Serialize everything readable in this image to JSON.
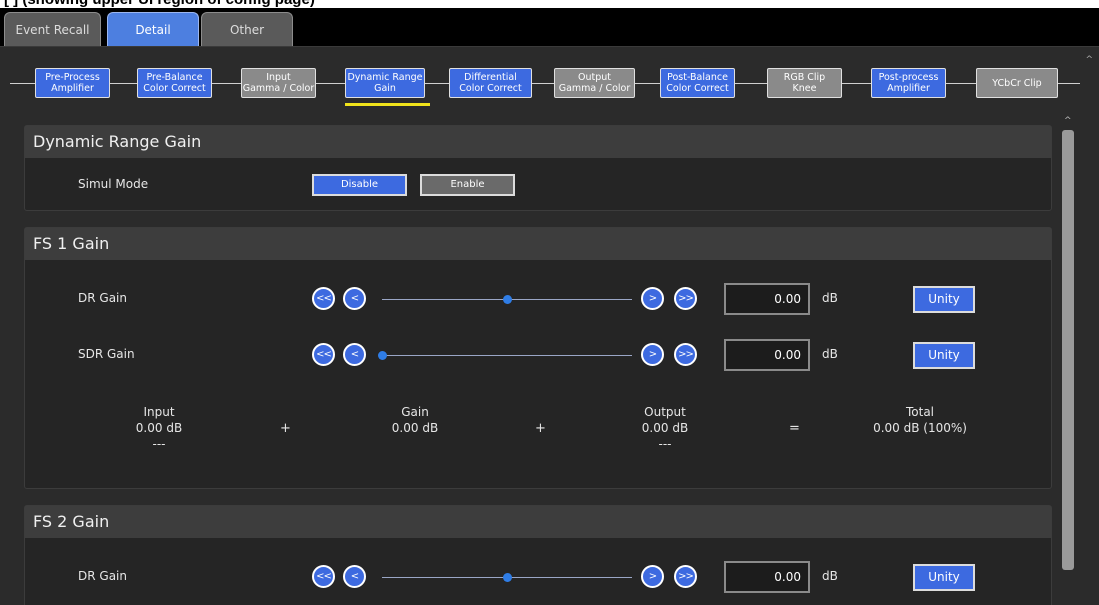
{
  "window": {
    "title_strip": "[ ] (showing upper UI region of config page)"
  },
  "tabs": [
    {
      "label": "Event Recall",
      "active": false
    },
    {
      "label": "Detail",
      "active": true
    },
    {
      "label": "Other",
      "active": false
    }
  ],
  "pipeline": {
    "stages": [
      {
        "line1": "Pre-Process",
        "line2": "Amplifier",
        "state": "blue"
      },
      {
        "line1": "Pre-Balance",
        "line2": "Color Correct",
        "state": "blue"
      },
      {
        "line1": "Input",
        "line2": "Gamma / Color",
        "state": "gray"
      },
      {
        "line1": "Dynamic Range",
        "line2": "Gain",
        "state": "blue",
        "selected": true
      },
      {
        "line1": "Differential",
        "line2": "Color Correct",
        "state": "blue"
      },
      {
        "line1": "Output",
        "line2": "Gamma / Color",
        "state": "gray"
      },
      {
        "line1": "Post-Balance",
        "line2": "Color Correct",
        "state": "blue"
      },
      {
        "line1": "RGB Clip",
        "line2": "Knee",
        "state": "gray"
      },
      {
        "line1": "Post-process",
        "line2": "Amplifier",
        "state": "blue"
      },
      {
        "line1": "YCbCr Clip",
        "line2": "",
        "state": "gray"
      }
    ]
  },
  "drg_panel": {
    "title": "Dynamic Range Gain",
    "simul_mode_label": "Simul Mode",
    "disable_label": "Disable",
    "enable_label": "Enable",
    "selected": "Disable"
  },
  "fs1_panel": {
    "title": "FS 1 Gain",
    "dr_gain": {
      "label": "DR Gain",
      "value": "0.00",
      "unit": "dB",
      "unity_label": "Unity",
      "slider_fraction": 0.5
    },
    "sdr_gain": {
      "label": "SDR Gain",
      "value": "0.00",
      "unit": "dB",
      "unity_label": "Unity",
      "slider_fraction": 0.0
    },
    "summary": {
      "input": {
        "label": "Input",
        "value": "0.00 dB",
        "sub": "---"
      },
      "plus1": "+",
      "gain": {
        "label": "Gain",
        "value": "0.00 dB"
      },
      "plus2": "+",
      "output": {
        "label": "Output",
        "value": "0.00 dB",
        "sub": "---"
      },
      "equals": "=",
      "total": {
        "label": "Total",
        "value": "0.00 dB (100%)"
      }
    }
  },
  "fs2_panel": {
    "title": "FS 2 Gain",
    "dr_gain": {
      "label": "DR Gain",
      "value": "0.00",
      "unit": "dB",
      "unity_label": "Unity",
      "slider_fraction": 0.5
    }
  },
  "step_buttons": {
    "fast_back": "<<",
    "back": "<",
    "fwd": ">",
    "fast_fwd": ">>"
  },
  "colors": {
    "accent_blue": "#3d6ae0",
    "inactive_gray": "#8a8a8a",
    "selected_underline": "#f0e31b",
    "panel_bg": "#252525"
  }
}
